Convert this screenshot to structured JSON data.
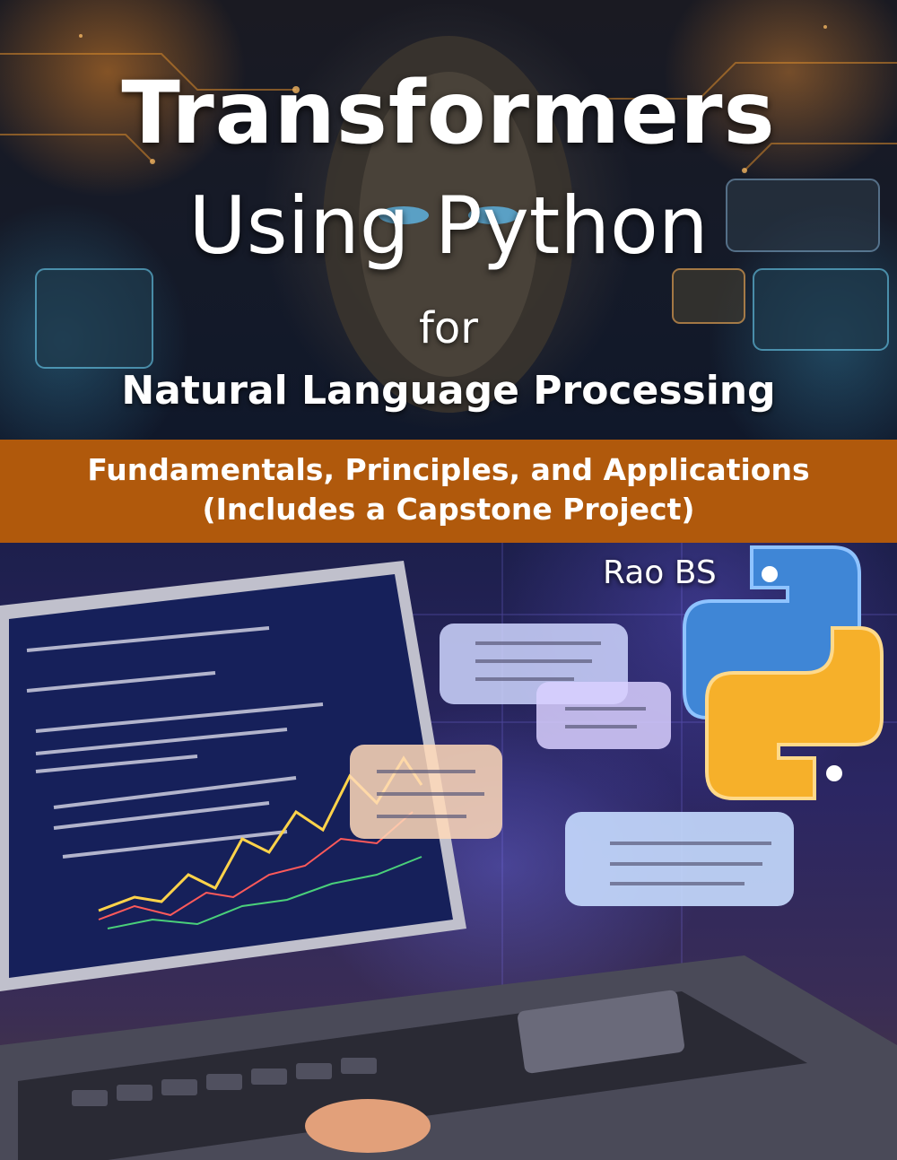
{
  "cover": {
    "title_line1": "Transformers",
    "title_line2": "Using Python",
    "title_for": "for",
    "title_line3": "Natural Language Processing",
    "subtitle_line1": "Fundamentals, Principles, and Applications",
    "subtitle_line2": "(Includes a Capstone Project)",
    "author": "Rao BS"
  },
  "colors": {
    "band": "#b0590c",
    "python_blue": "#3f86d6",
    "python_yellow": "#f6b02a",
    "screen": "#16205a",
    "bubble": "#cfd6ff"
  },
  "art": {
    "top_scene": "robot-face-with-circuit-panels",
    "bottom_scene": "laptop-with-code-and-chat-bubbles",
    "logo": "python-logo-icon"
  }
}
